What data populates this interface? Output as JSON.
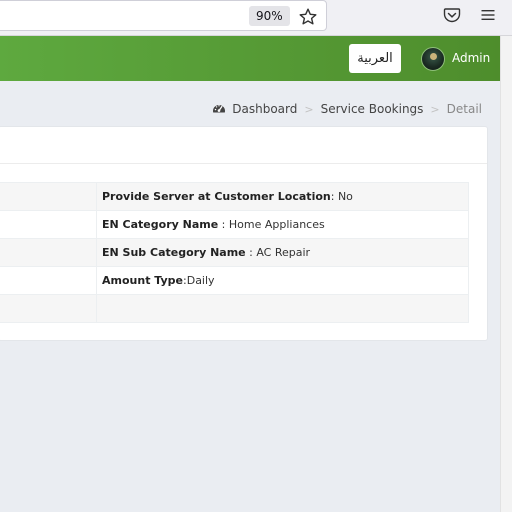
{
  "browser": {
    "zoom": "90%",
    "icons": [
      "bookmark-star-icon",
      "pocket-icon",
      "hamburger-menu-icon"
    ]
  },
  "header": {
    "language_button": "العربية",
    "user_name": "Admin",
    "colors": {
      "start": "#5ea93f",
      "end": "#4e8d2c"
    }
  },
  "breadcrumb": {
    "icon": "dashboard-icon",
    "items": [
      "Dashboard",
      "Service Bookings",
      "Detail"
    ],
    "separator": ">"
  },
  "details": [
    {
      "label": "Provide Server at Customer Location",
      "separator": ": ",
      "value": "No"
    },
    {
      "label": "EN Category Name",
      "separator": " : ",
      "value": "Home Appliances"
    },
    {
      "label": "EN Sub Category Name",
      "separator": " : ",
      "value": "AC Repair"
    },
    {
      "label": "Amount Type",
      "separator": ":",
      "value": "Daily"
    },
    {
      "label": "",
      "separator": "",
      "value": ""
    }
  ]
}
